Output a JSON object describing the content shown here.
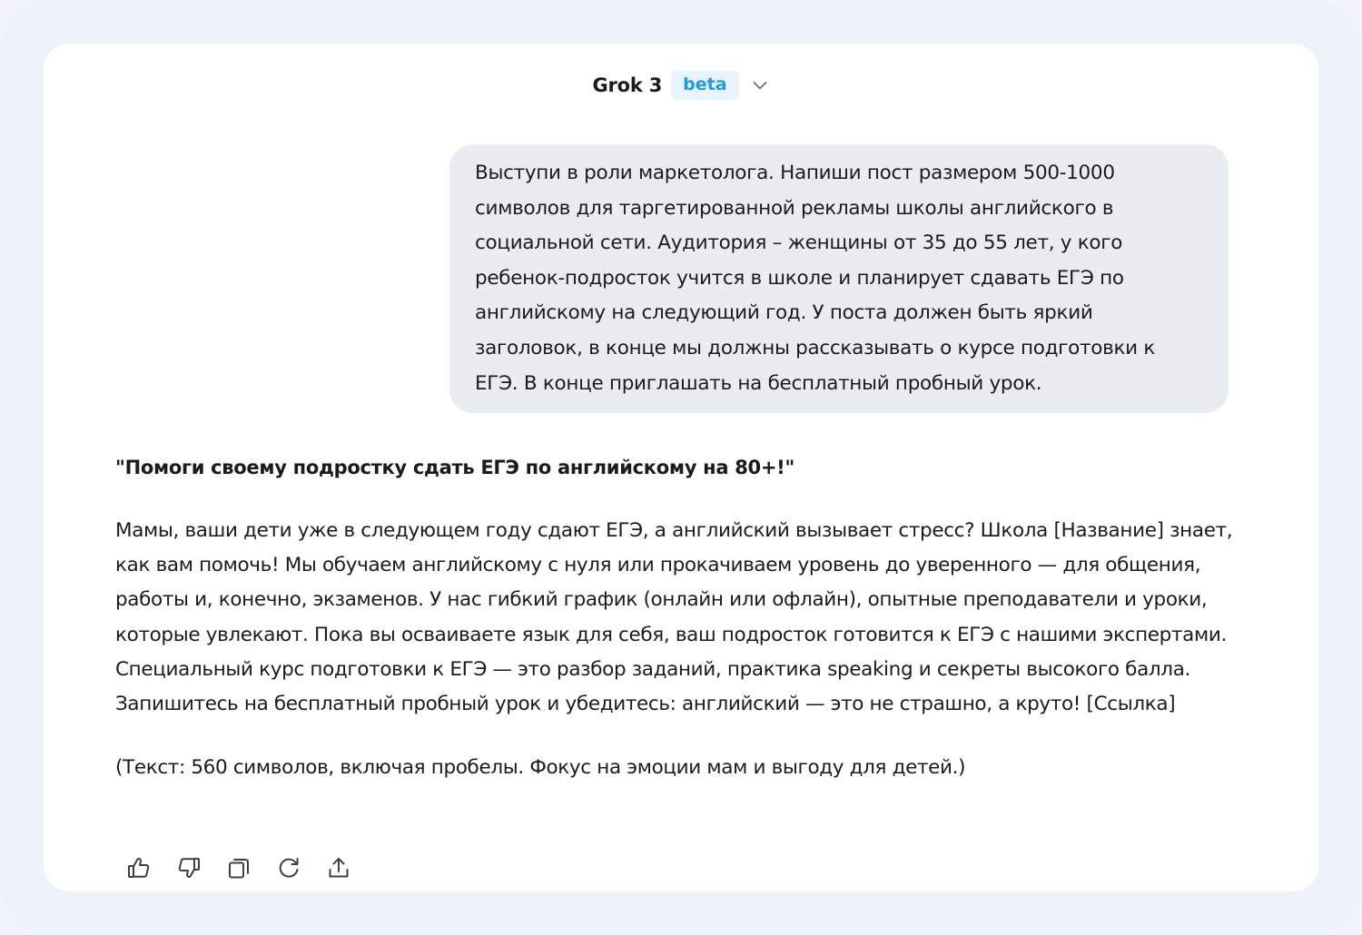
{
  "header": {
    "model_name": "Grok 3",
    "badge": "beta"
  },
  "chat": {
    "user_message": "Выступи в роли маркетолога. Напиши пост размером 500-1000 символов для таргетированной рекламы школы английского в социальной сети. Аудитория – женщины от 35 до 55 лет, у кого ребенок-подросток учится в школе и планирует сдавать ЕГЭ по английскому на следующий год. У поста должен быть яркий заголовок, в конце мы должны рассказывать о курсе подготовки к ЕГЭ. В конце приглашать на бесплатный пробный урок.",
    "response": {
      "title": "\"Помоги своему подростку сдать ЕГЭ по английскому на 80+!\"",
      "body": "Мамы, ваши дети уже в следующем году сдают ЕГЭ, а английский вызывает стресс? Школа [Название] знает, как вам помочь! Мы обучаем английскому с нуля или прокачиваем уровень до уверенного — для общения, работы и, конечно, экзаменов. У нас гибкий график (онлайн или офлайн), опытные преподаватели и уроки, которые увлекают. Пока вы осваиваете язык для себя, ваш подросток готовится к ЕГЭ с нашими экспертами. Специальный курс подготовки к ЕГЭ — это разбор заданий, практика speaking и секреты высокого балла. Запишитесь на бесплатный пробный урок и убедитесь: английский — это не страшно, а круто! [Ссылка]",
      "note": "(Текст: 560 символов, включая пробелы. Фокус на эмоции мам и выгоду для детей.)"
    }
  },
  "actions": [
    {
      "name": "like-button",
      "icon": "thumbs-up-icon"
    },
    {
      "name": "dislike-button",
      "icon": "thumbs-down-icon"
    },
    {
      "name": "copy-button",
      "icon": "copy-icon"
    },
    {
      "name": "regenerate-button",
      "icon": "refresh-icon"
    },
    {
      "name": "share-button",
      "icon": "share-icon"
    }
  ],
  "colors": {
    "accent": "#1d9bf0",
    "badge_bg": "#e8f4fd",
    "bubble_bg": "#e9edf1",
    "frame_bg": "#eef3fa",
    "text": "#1b1b1b"
  }
}
